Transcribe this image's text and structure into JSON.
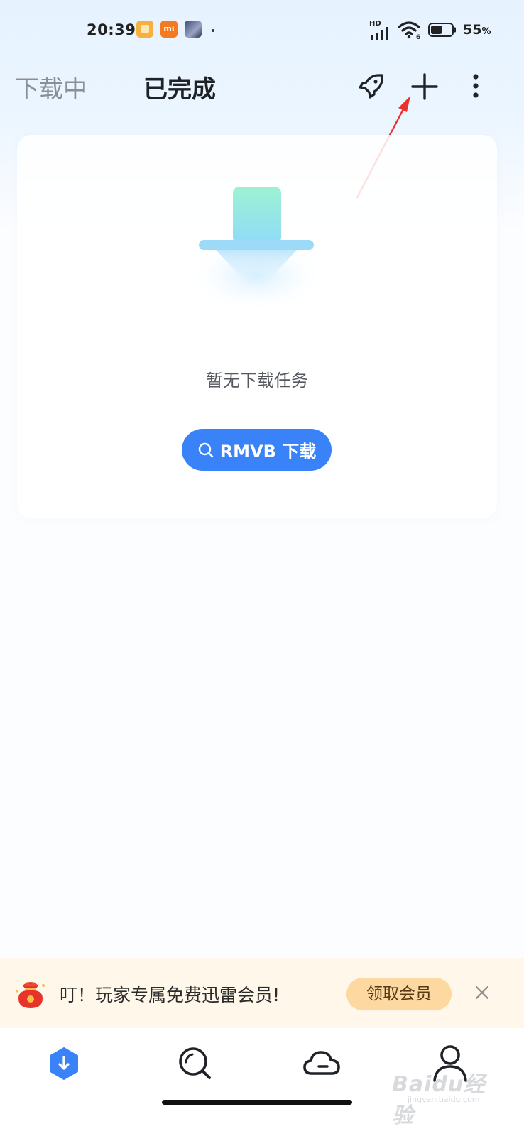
{
  "status_bar": {
    "time": "20:39",
    "notification_mi": "mi",
    "network_label": "HD",
    "wifi_label": "6",
    "battery_percent": "55",
    "battery_unit": "%",
    "battery_level": 0.55
  },
  "header": {
    "tab_downloading": "下载中",
    "tab_completed": "已完成",
    "active_tab": "tab_completed"
  },
  "empty_state": {
    "message": "暂无下载任务",
    "search_button_label": "RMVB 下载"
  },
  "promo": {
    "text": "叮！玩家专属免费迅雷会员!",
    "button_label": "领取会员"
  },
  "bottom_nav": {
    "items": [
      "download-icon",
      "discover-icon",
      "cloud-icon",
      "profile-icon"
    ],
    "active": "download-icon"
  },
  "watermark": {
    "main": "Baidu经验",
    "sub": "jingyan.baidu.com"
  },
  "colors": {
    "accent": "#3a82f7",
    "annotation_arrow": "#e8322d",
    "promo_background": "#fff8ea",
    "promo_button": "#fdd8a0"
  }
}
